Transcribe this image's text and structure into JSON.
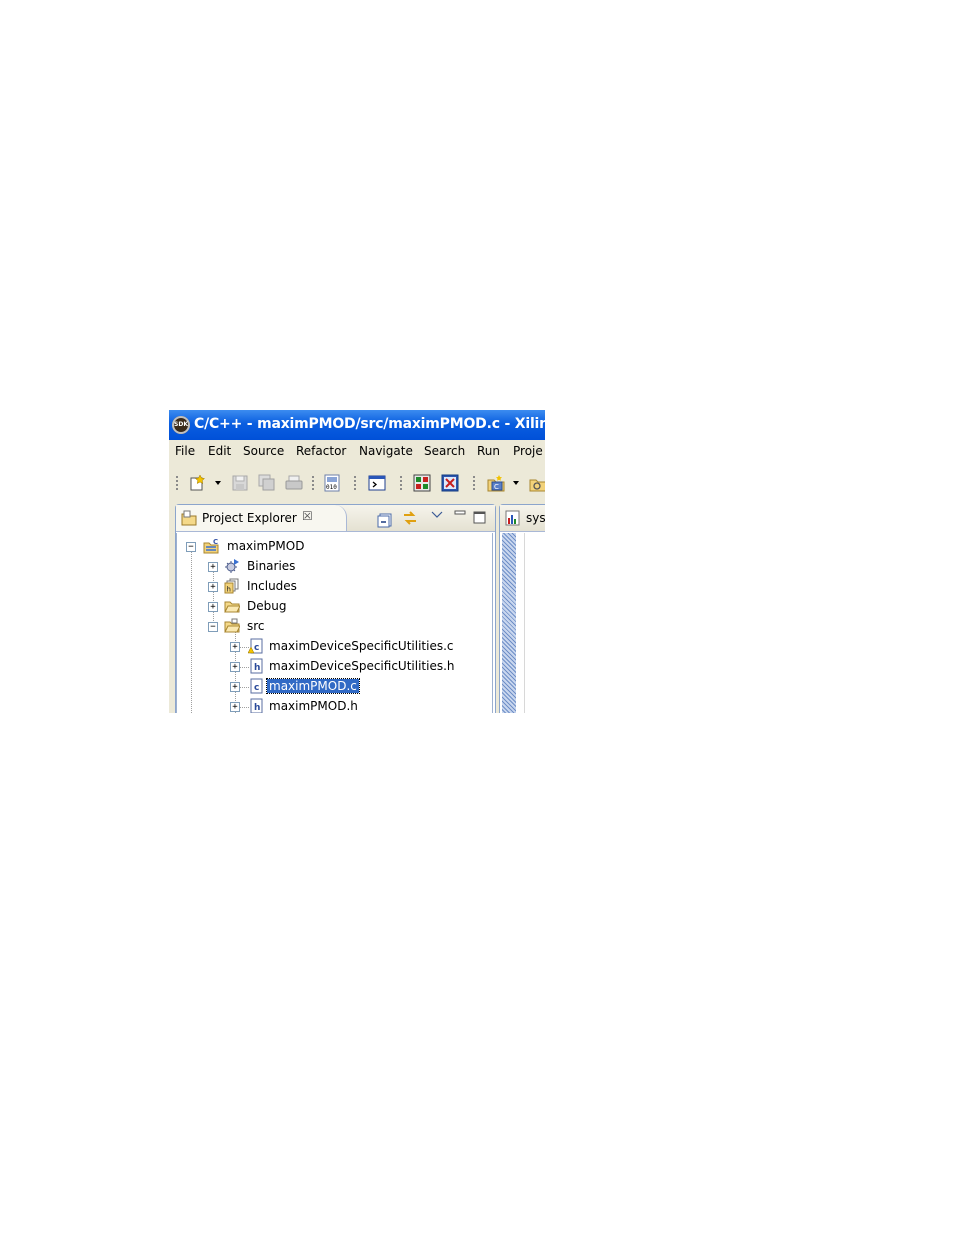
{
  "window": {
    "title": "C/C++ - maximPMOD/src/maximPMOD.c - Xilinx S",
    "logo_text": "SDK"
  },
  "menu": [
    "File",
    "Edit",
    "Source",
    "Refactor",
    "Navigate",
    "Search",
    "Run",
    "Proje"
  ],
  "project_explorer": {
    "tab_label": "Project Explorer",
    "close_glyph": "☒"
  },
  "tree": {
    "root": "maximPMOD",
    "binaries": "Binaries",
    "includes": "Includes",
    "debug": "Debug",
    "src": "src",
    "files": [
      "maximDeviceSpecificUtilities.c",
      "maximDeviceSpecificUtilities.h",
      "maximPMOD.c",
      "maximPMOD.h"
    ],
    "selected_file": "maximPMOD.c"
  },
  "editor_tab": {
    "label": "sys"
  },
  "colors": {
    "title_blue": "#0a5ee0",
    "selection": "#316ac5",
    "chrome": "#ece9d8"
  }
}
